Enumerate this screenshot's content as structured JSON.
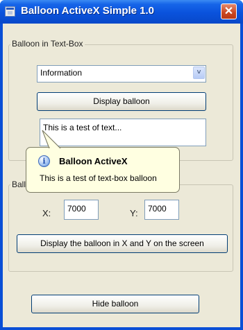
{
  "window": {
    "title": "Balloon ActiveX Simple 1.0",
    "close_glyph": "✕"
  },
  "group_textbox": {
    "label": "Balloon in Text-Box",
    "icon_type_select": {
      "value": "Information"
    },
    "display_button": "Display balloon",
    "textbox_value": "This is a test of text..."
  },
  "group_position": {
    "label": "Balloon on the screen",
    "x_label": "X:",
    "x_value": "7000",
    "y_label": "Y:",
    "y_value": "7000",
    "display_xy_button": "Display the balloon in X and Y on the screen"
  },
  "hide_button": "Hide balloon",
  "balloon": {
    "icon": "info-icon",
    "icon_glyph": "i",
    "title": "Balloon ActiveX",
    "body": "This is a test of text-box balloon"
  },
  "colors": {
    "titlebar": "#0a52dc",
    "client": "#ece9d8",
    "balloon_bg": "#ffffe1",
    "close_button": "#c9451f"
  }
}
